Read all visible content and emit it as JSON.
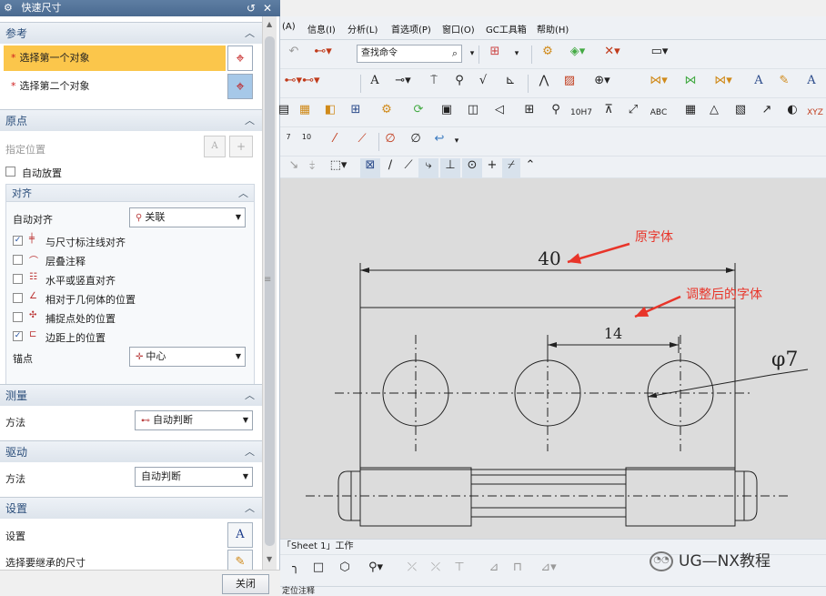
{
  "dialog": {
    "title": "快速尺寸",
    "title_buttons": {
      "reset": "↺",
      "close": "✕"
    },
    "reference": {
      "heading": "参考",
      "first_object": "选择第一个对象",
      "second_object": "选择第二个对象",
      "required_marker": "*"
    },
    "origin": {
      "heading": "原点",
      "specify_location": "指定位置",
      "auto_place": "自动放置"
    },
    "align": {
      "heading": "对齐",
      "auto_align_label": "自动对齐",
      "auto_align_value": "关联",
      "options": [
        {
          "label": "与尺寸标注线对齐",
          "checked": true
        },
        {
          "label": "层叠注释",
          "checked": false
        },
        {
          "label": "水平或竖直对齐",
          "checked": false
        },
        {
          "label": "相对于几何体的位置",
          "checked": false
        },
        {
          "label": "捕捉点处的位置",
          "checked": false
        },
        {
          "label": "边距上的位置",
          "checked": true
        }
      ],
      "anchor_label": "锚点",
      "anchor_value": "中心"
    },
    "measure": {
      "heading": "测量",
      "method_label": "方法",
      "method_value": "自动判断"
    },
    "drive": {
      "heading": "驱动",
      "method_label": "方法",
      "method_value": "自动判断"
    },
    "settings": {
      "heading": "设置",
      "settings_label": "设置",
      "inherit_label": "选择要继承的尺寸"
    },
    "close_button": "关闭",
    "check_mark": "✓",
    "grip": "≡"
  },
  "menu": {
    "items": [
      "(A)",
      "信息(I)",
      "分析(L)",
      "首选项(P)",
      "窗口(O)",
      "GC工具箱",
      "帮助(H)"
    ]
  },
  "toolbar": {
    "search_placeholder": "查找命令",
    "row4_texts": [
      "10H7",
      "ABC",
      "XYZ"
    ]
  },
  "drawing": {
    "dim_40": "40",
    "dim_14": "14",
    "dim_phi": "φ7",
    "note_original": "原字体",
    "note_adjusted": "调整后的字体",
    "annotation_color": "#e8352a"
  },
  "status": {
    "sheet": "「Sheet 1」工作",
    "prompt": "定位注释"
  },
  "watermark": "UG—NX教程"
}
